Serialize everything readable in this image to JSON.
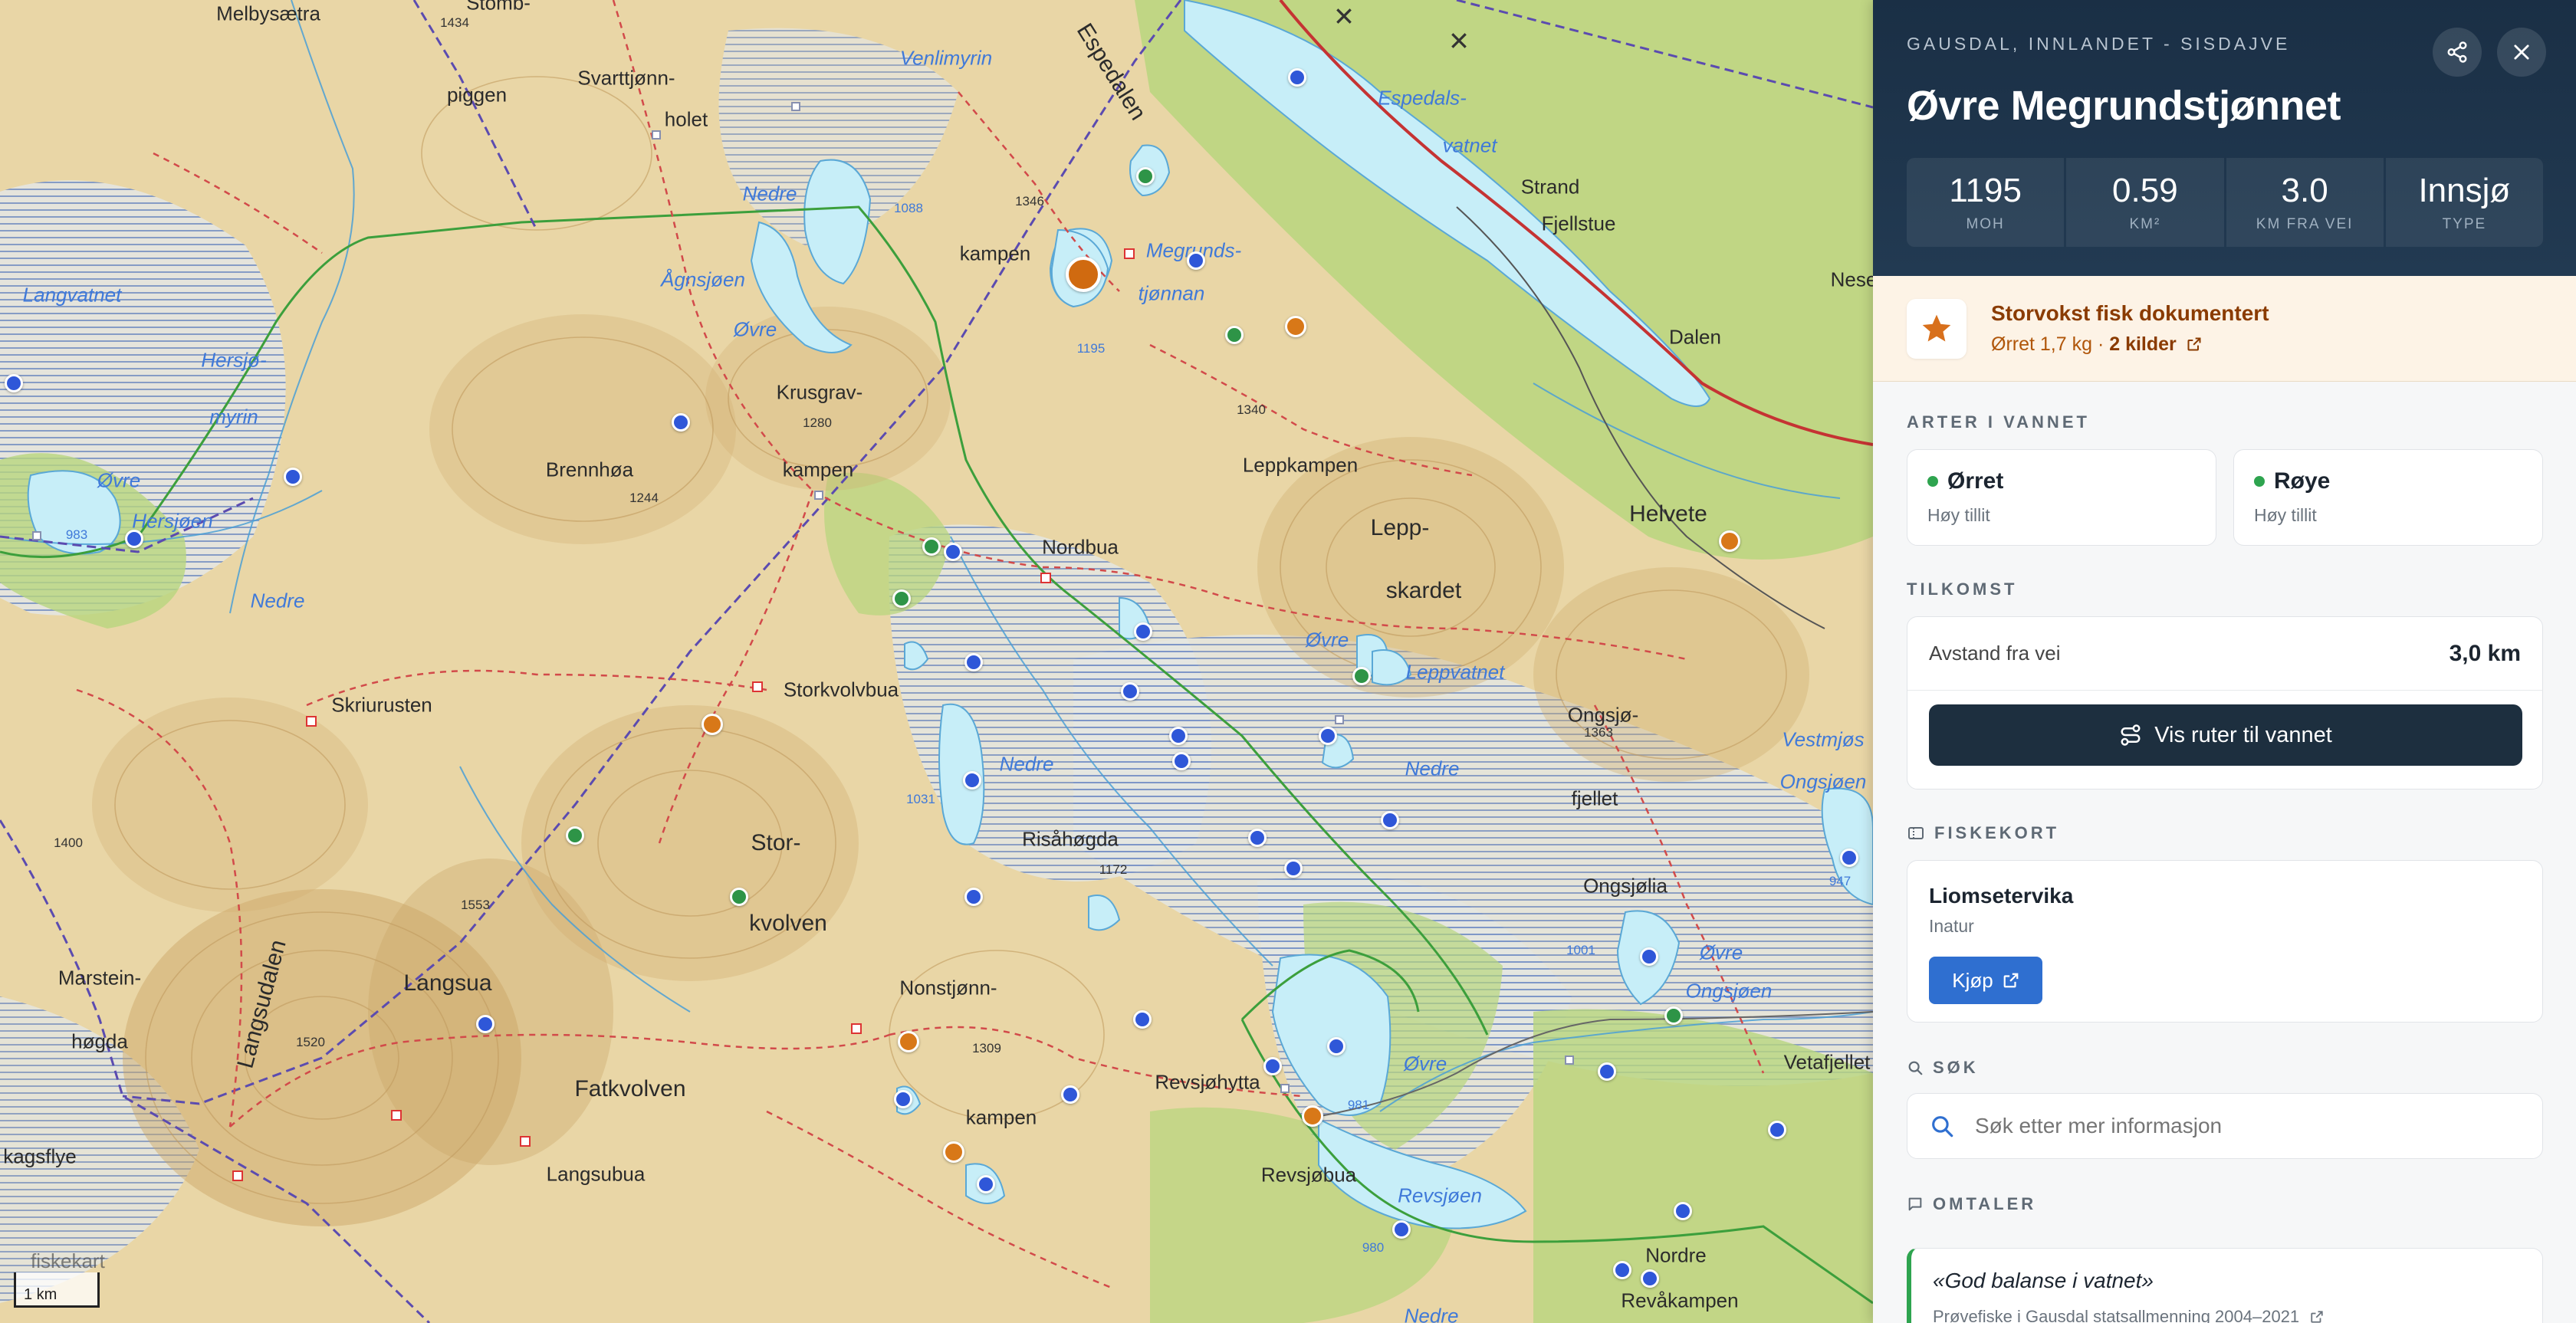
{
  "map": {
    "scale_label": "1 km",
    "attribution": "fiskekart",
    "labels": [
      {
        "text": "Melbysætra",
        "type": "place"
      },
      {
        "text": "Stomb-",
        "type": "place"
      },
      {
        "text": "1434",
        "type": "elev"
      },
      {
        "text": "Svarttjønn-",
        "type": "place"
      },
      {
        "text": "piggen",
        "type": "place"
      },
      {
        "text": "holet",
        "type": "place"
      },
      {
        "text": "Venlimyrin",
        "type": "water"
      },
      {
        "text": "Espedalen",
        "type": "rot"
      },
      {
        "text": "Espedals-",
        "type": "water"
      },
      {
        "text": "vatnet",
        "type": "water"
      },
      {
        "text": "Nedre",
        "type": "water"
      },
      {
        "text": "1088",
        "type": "elev-water"
      },
      {
        "text": "1346",
        "type": "elev"
      },
      {
        "text": "Megrunds-",
        "type": "water"
      },
      {
        "text": "tjønnan",
        "type": "water"
      },
      {
        "text": "kampen",
        "type": "place"
      },
      {
        "text": "1195",
        "type": "elev-water"
      },
      {
        "text": "Strand",
        "type": "place"
      },
      {
        "text": "Fjellstue",
        "type": "place"
      },
      {
        "text": "Langvatnet",
        "type": "water"
      },
      {
        "text": "Ågnsjøen",
        "type": "water"
      },
      {
        "text": "Øvre",
        "type": "water"
      },
      {
        "text": "Hersjø-",
        "type": "water"
      },
      {
        "text": "myrin",
        "type": "water"
      },
      {
        "text": "Krusgrav-",
        "type": "place"
      },
      {
        "text": "1280",
        "type": "elev"
      },
      {
        "text": "kampen",
        "type": "place"
      },
      {
        "text": "1340",
        "type": "elev"
      },
      {
        "text": "Dalen",
        "type": "place"
      },
      {
        "text": "Nese",
        "type": "place"
      },
      {
        "text": "Brennhøa",
        "type": "place"
      },
      {
        "text": "1244",
        "type": "elev"
      },
      {
        "text": "Leppkampen",
        "type": "place"
      },
      {
        "text": "Øvre",
        "type": "water"
      },
      {
        "text": "Hersjøen",
        "type": "water"
      },
      {
        "text": "983",
        "type": "elev-water"
      },
      {
        "text": "Lepp-",
        "type": "big"
      },
      {
        "text": "skardet",
        "type": "big"
      },
      {
        "text": "Helvete",
        "type": "big"
      },
      {
        "text": "Nedre",
        "type": "water"
      },
      {
        "text": "Nordbua",
        "type": "place"
      },
      {
        "text": "Øvre",
        "type": "water"
      },
      {
        "text": "Leppvatnet",
        "type": "water"
      },
      {
        "text": "Skriurusten",
        "type": "place"
      },
      {
        "text": "Storkvolvbua",
        "type": "place"
      },
      {
        "text": "Ongsjø-",
        "type": "place"
      },
      {
        "text": "1363",
        "type": "elev"
      },
      {
        "text": "Nedre",
        "type": "water"
      },
      {
        "text": "Vestmjøs",
        "type": "water"
      },
      {
        "text": "Nedre",
        "type": "water"
      },
      {
        "text": "Ongsjøen",
        "type": "water"
      },
      {
        "text": "1031",
        "type": "elev-water"
      },
      {
        "text": "fjellet",
        "type": "place"
      },
      {
        "text": "1400",
        "type": "elev"
      },
      {
        "text": "Risåhøgda",
        "type": "place"
      },
      {
        "text": "1172",
        "type": "elev"
      },
      {
        "text": "Stor-",
        "type": "big"
      },
      {
        "text": "947",
        "type": "elev-water"
      },
      {
        "text": "Ongsjølia",
        "type": "place"
      },
      {
        "text": "1553",
        "type": "elev"
      },
      {
        "text": "kvolven",
        "type": "big"
      },
      {
        "text": "1001",
        "type": "elev-water"
      },
      {
        "text": "Marstein-",
        "type": "place"
      },
      {
        "text": "Langsudalen",
        "type": "rot"
      },
      {
        "text": "Langsua",
        "type": "big"
      },
      {
        "text": "Nonstjønn-",
        "type": "place"
      },
      {
        "text": "Øvre",
        "type": "water"
      },
      {
        "text": "Ongsjøen",
        "type": "water"
      },
      {
        "text": "høgda",
        "type": "place"
      },
      {
        "text": "1520",
        "type": "elev"
      },
      {
        "text": "1309",
        "type": "elev"
      },
      {
        "text": "Øvre",
        "type": "water"
      },
      {
        "text": "Vetafjellet",
        "type": "place"
      },
      {
        "text": "Fatkvolven",
        "type": "big"
      },
      {
        "text": "Revsjøhytta",
        "type": "place"
      },
      {
        "text": "981",
        "type": "elev-water"
      },
      {
        "text": "kampen",
        "type": "place"
      },
      {
        "text": "kagsflye",
        "type": "place"
      },
      {
        "text": "Langsubua",
        "type": "place"
      },
      {
        "text": "Revsjøbua",
        "type": "place"
      },
      {
        "text": "Revsjøen",
        "type": "water"
      },
      {
        "text": "980",
        "type": "elev-water"
      },
      {
        "text": "Nordre",
        "type": "place"
      },
      {
        "text": "Revåkampen",
        "type": "place"
      },
      {
        "text": "Nedre",
        "type": "water"
      }
    ]
  },
  "panel": {
    "breadcrumb": "GAUSDAL, INNLANDET - SISDAJVE",
    "title": "Øvre Megrundstjønnet",
    "share_icon": "share-icon",
    "close_icon": "close-icon",
    "stats": [
      {
        "value": "1195",
        "unit": "MOH"
      },
      {
        "value": "0.59",
        "unit": "KM²"
      },
      {
        "value": "3.0",
        "unit": "KM FRA VEI"
      },
      {
        "value": "Innsjø",
        "unit": "TYPE"
      }
    ],
    "trophy": {
      "title": "Storvokst fisk dokumentert",
      "detail": "Ørret 1,7 kg · ",
      "link": "2 kilder"
    },
    "species_label": "ARTER I VANNET",
    "species": [
      {
        "name": "Ørret",
        "confidence": "Høy tillit"
      },
      {
        "name": "Røye",
        "confidence": "Høy tillit"
      }
    ],
    "access_label": "TILKOMST",
    "access": {
      "distance_label": "Avstand fra vei",
      "distance_value": "3,0 km",
      "routes_button": "Vis ruter til vannet"
    },
    "fiskekort_label": "FISKEKORT",
    "fiskekort": {
      "name": "Liomsetervika",
      "vendor": "Inatur",
      "buy_button": "Kjøp"
    },
    "search_label": "SØK",
    "search": {
      "placeholder": "Søk etter mer informasjon"
    },
    "reviews_label": "OMTALER",
    "review": {
      "quote": "«God balanse i vatnet»",
      "source": "Prøvefiske i Gausdal statsallmenning 2004–2021"
    }
  },
  "colors": {
    "header_bg": "#1a2f45",
    "marker_blue": "#2f57d8",
    "marker_green": "#2e9447",
    "marker_orange": "#d87818",
    "primary_button": "#1d2f3f",
    "buy_button": "#2f6fd0",
    "trophy_bg": "#fdf3e6"
  }
}
